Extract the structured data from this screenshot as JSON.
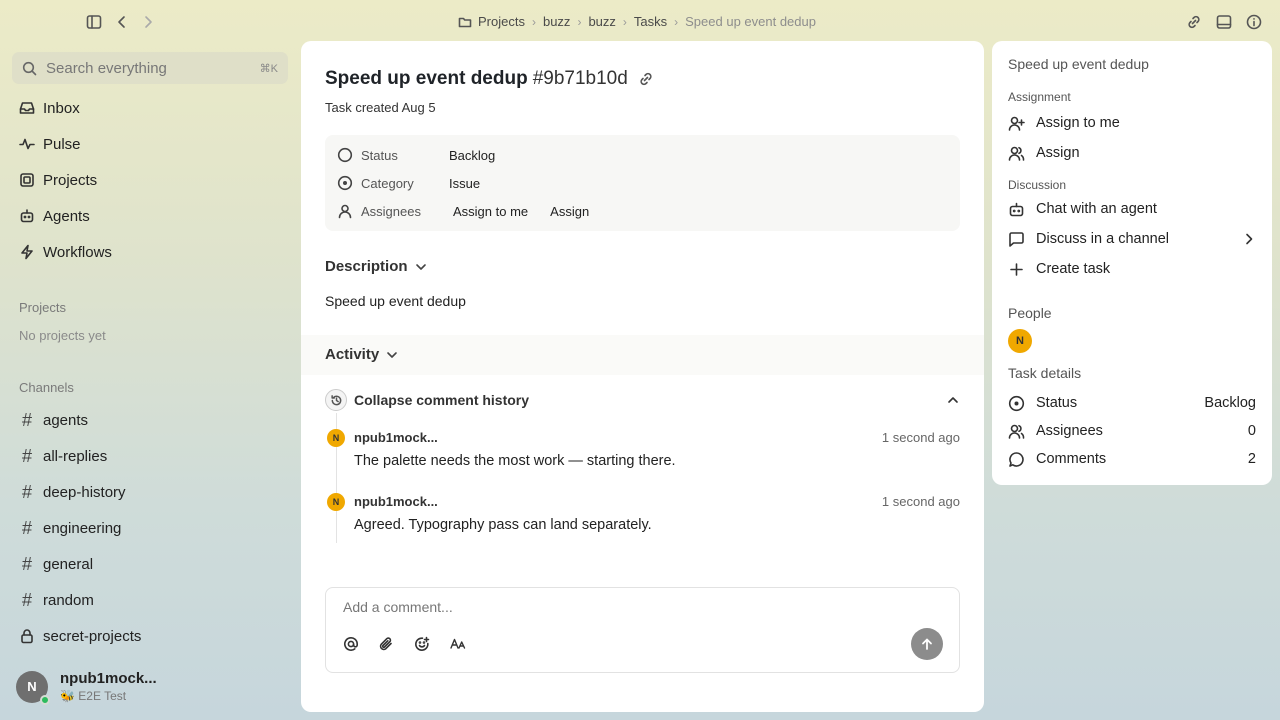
{
  "topbar": {
    "breadcrumb": [
      "Projects",
      "buzz",
      "buzz",
      "Tasks",
      "Speed up event dedup"
    ]
  },
  "sidebar": {
    "search_placeholder": "Search everything",
    "search_shortcut": "⌘K",
    "nav": [
      {
        "label": "Inbox",
        "icon": "inbox-icon"
      },
      {
        "label": "Pulse",
        "icon": "pulse-icon"
      },
      {
        "label": "Projects",
        "icon": "projects-icon"
      },
      {
        "label": "Agents",
        "icon": "agents-icon"
      },
      {
        "label": "Workflows",
        "icon": "workflows-icon"
      }
    ],
    "projects_label": "Projects",
    "projects_empty": "No projects yet",
    "channels_label": "Channels",
    "channels": [
      "agents",
      "all-replies",
      "deep-history",
      "engineering",
      "general",
      "random",
      "secret-projects"
    ],
    "user": {
      "initial": "N",
      "name": "npub1mock...",
      "status": "🐝 E2E Test"
    }
  },
  "task": {
    "title": "Speed up event dedup",
    "id": "#9b71b10d",
    "created": "Task created Aug 5",
    "props": {
      "status_label": "Status",
      "status_value": "Backlog",
      "category_label": "Category",
      "category_value": "Issue",
      "assignees_label": "Assignees",
      "assign_me": "Assign to me",
      "assign": "Assign"
    },
    "description_label": "Description",
    "description": "Speed up event dedup",
    "activity_label": "Activity",
    "history_label": "Collapse comment history",
    "comments": [
      {
        "initial": "N",
        "author": "npub1mock...",
        "time": "1 second ago",
        "body": "The palette needs the most work — starting there."
      },
      {
        "initial": "N",
        "author": "npub1mock...",
        "time": "1 second ago",
        "body": "Agreed. Typography pass can land separately."
      }
    ],
    "composer_placeholder": "Add a comment..."
  },
  "rpanel": {
    "title": "Speed up event dedup",
    "assignment_label": "Assignment",
    "assign_me": "Assign to me",
    "assign": "Assign",
    "discussion_label": "Discussion",
    "chat_agent": "Chat with an agent",
    "discuss_channel": "Discuss in a channel",
    "create_task": "Create task",
    "people_label": "People",
    "people_initial": "N",
    "details_label": "Task details",
    "details": {
      "status_label": "Status",
      "status_value": "Backlog",
      "assignees_label": "Assignees",
      "assignees_value": "0",
      "comments_label": "Comments",
      "comments_value": "2"
    }
  },
  "colors": {
    "avatar_accent": "#f0a800",
    "online": "#2dbb5d",
    "send_button": "#8c8c8c"
  }
}
